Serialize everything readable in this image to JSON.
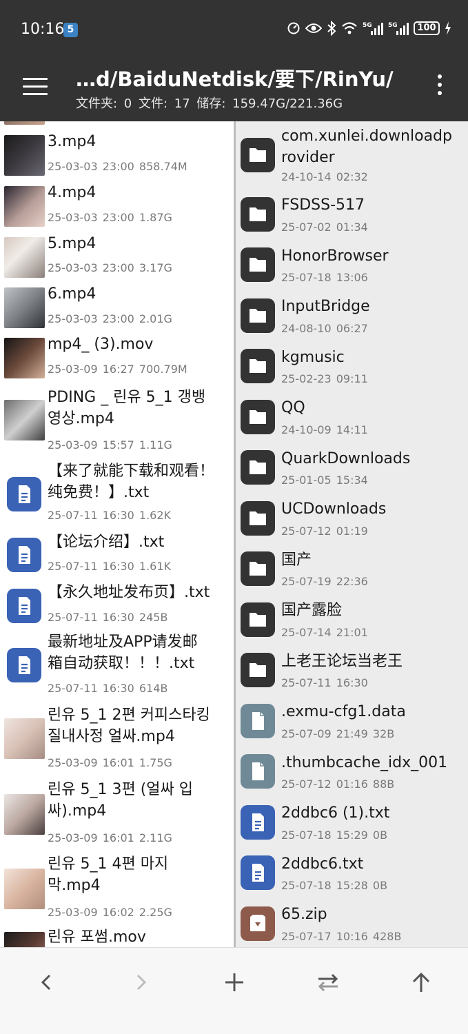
{
  "status_bar": {
    "time": "10:16",
    "carrier_badge": "5",
    "battery": "100",
    "icons": [
      "speed-icon",
      "eye-icon",
      "bluetooth-icon",
      "wifi-icon",
      "signal-5g-icon",
      "signal-5g-icon",
      "charging-icon"
    ]
  },
  "header": {
    "path": "…d/BaiduNetdisk/要下/RinYu/",
    "info": "文件夹: 0  文件: 17  储存: 159.47G/221.36G"
  },
  "left_pane": {
    "items": [
      {
        "name": "3.mp4",
        "meta": "25-03-03 23:00  858.74M",
        "type": "video"
      },
      {
        "name": "4.mp4",
        "meta": "25-03-03 23:00  1.87G",
        "type": "video"
      },
      {
        "name": "5.mp4",
        "meta": "25-03-03 23:00  3.17G",
        "type": "video"
      },
      {
        "name": "6.mp4",
        "meta": "25-03-03 23:00  2.01G",
        "type": "video"
      },
      {
        "name": "mp4_ (3).mov",
        "meta": "25-03-09 16:27  700.79M",
        "type": "video"
      },
      {
        "name": "PDING _ 린유 5_1 갱뱅\n영상.mp4",
        "meta": "25-03-09 15:57  1.11G",
        "type": "video"
      },
      {
        "name": "【来了就能下载和观看！\n纯免费！】.txt",
        "meta": "25-07-11 16:30  1.62K",
        "type": "text"
      },
      {
        "name": "【论坛介绍】.txt",
        "meta": "25-07-11 16:30  1.61K",
        "type": "text"
      },
      {
        "name": "【永久地址发布页】.txt",
        "meta": "25-07-11 16:30  245B",
        "type": "text"
      },
      {
        "name": "最新地址及APP请发邮\n箱自动获取！！！.txt",
        "meta": "25-07-11 16:30  614B",
        "type": "text"
      },
      {
        "name": "린유 5_1 2편 커피스타킹\n질내사정 얼싸.mp4",
        "meta": "25-03-09 16:01  1.75G",
        "type": "video"
      },
      {
        "name": "린유 5_1 3편 (얼싸 입\n싸).mp4",
        "meta": "25-03-09 16:01  2.11G",
        "type": "video"
      },
      {
        "name": "린유 5_1 4편 마지\n막.mp4",
        "meta": "25-03-09 16:02  2.25G",
        "type": "video"
      },
      {
        "name": "린유 포썸.mov",
        "meta": "",
        "type": "video"
      }
    ]
  },
  "right_pane": {
    "items": [
      {
        "name": "com.xunlei.downloadp\nrovider",
        "meta": "24-10-14 02:32",
        "type": "folder"
      },
      {
        "name": "FSDSS-517",
        "meta": "25-07-02 01:34",
        "type": "folder"
      },
      {
        "name": "HonorBrowser",
        "meta": "25-07-18 13:06",
        "type": "folder"
      },
      {
        "name": "InputBridge",
        "meta": "24-08-10 06:27",
        "type": "folder"
      },
      {
        "name": "kgmusic",
        "meta": "25-02-23 09:11",
        "type": "folder"
      },
      {
        "name": "QQ",
        "meta": "24-10-09 14:11",
        "type": "folder"
      },
      {
        "name": "QuarkDownloads",
        "meta": "25-01-05 15:34",
        "type": "folder"
      },
      {
        "name": "UCDownloads",
        "meta": "25-07-12 01:19",
        "type": "folder"
      },
      {
        "name": "国产",
        "meta": "25-07-19 22:36",
        "type": "folder"
      },
      {
        "name": "国产露脸",
        "meta": "25-07-14 21:01",
        "type": "folder"
      },
      {
        "name": "上老王论坛当老王",
        "meta": "25-07-11 16:30",
        "type": "folder"
      },
      {
        "name": ".exmu-cfg1.data",
        "meta": "25-07-09 21:49  32B",
        "type": "generic"
      },
      {
        "name": ".thumbcache_idx_001",
        "meta": "25-07-12 01:16  88B",
        "type": "generic"
      },
      {
        "name": "2ddbc6 (1).txt",
        "meta": "25-07-18 15:29  0B",
        "type": "text"
      },
      {
        "name": "2ddbc6.txt",
        "meta": "25-07-18 15:28  0B",
        "type": "text"
      },
      {
        "name": "65.zip",
        "meta": "25-07-17 10:16  428B",
        "type": "archive"
      }
    ]
  },
  "bottom_bar": {
    "buttons": [
      "back-icon",
      "forward-icon",
      "add-icon",
      "swap-icon",
      "up-icon"
    ]
  },
  "colors": {
    "header_bg": "#333333",
    "text_file_icon": "#3a62b5",
    "generic_file_icon": "#6f8a96",
    "archive_icon": "#8d5a4b",
    "folder_icon": "#333333"
  }
}
